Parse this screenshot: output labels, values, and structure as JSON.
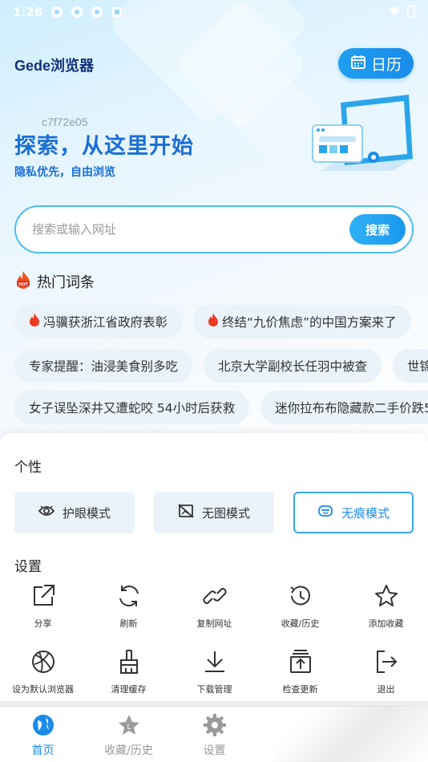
{
  "status_bar": {
    "time": "1:26"
  },
  "header": {
    "app_title": "Gede浏览器",
    "calendar_label": "日历"
  },
  "hero": {
    "code": "c7f72e05",
    "title": "探索，从这里开始",
    "subtitle": "隐私优先，自由浏览"
  },
  "search": {
    "placeholder": "搜索或输入网址",
    "value": "",
    "button_label": "搜索"
  },
  "hot": {
    "title": "热门词条",
    "rows": [
      [
        {
          "text": "冯骥获浙江省政府表彰",
          "fire": true
        },
        {
          "text": "终结“九价焦虑”的中国方案来了",
          "fire": true
        }
      ],
      [
        {
          "text": "专家提醒：油浸美食别多吃",
          "fire": false
        },
        {
          "text": "北京大学副校长任羽中被查",
          "fire": false
        },
        {
          "text": "世锦",
          "fire": false
        }
      ],
      [
        {
          "text": "女子误坠深井又遭蛇咬 54小时后获救",
          "fire": false
        },
        {
          "text": "迷你拉布布隐藏款二手价跌5",
          "fire": false
        }
      ]
    ]
  },
  "sheet": {
    "personal_title": "个性",
    "modes": [
      {
        "label": "护眼模式",
        "icon": "eye-icon",
        "active": false
      },
      {
        "label": "无图模式",
        "icon": "no-image-icon",
        "active": false
      },
      {
        "label": "无痕模式",
        "icon": "incognito-icon",
        "active": true
      }
    ],
    "settings_title": "设置",
    "settings": [
      {
        "label": "分享",
        "icon": "share-icon"
      },
      {
        "label": "刷新",
        "icon": "refresh-icon"
      },
      {
        "label": "复制网址",
        "icon": "link-icon"
      },
      {
        "label": "收藏/历史",
        "icon": "history-icon"
      },
      {
        "label": "添加收藏",
        "icon": "star-icon"
      },
      {
        "label": "设为默认浏览器",
        "icon": "globe-icon"
      },
      {
        "label": "清理缓存",
        "icon": "broom-icon"
      },
      {
        "label": "下载管理",
        "icon": "download-icon"
      },
      {
        "label": "检查更新",
        "icon": "update-icon"
      },
      {
        "label": "退出",
        "icon": "exit-icon"
      }
    ]
  },
  "nav": {
    "items": [
      {
        "label": "首页",
        "icon": "home-globe-icon",
        "active": true
      },
      {
        "label": "收藏/历史",
        "icon": "star-icon",
        "active": false
      },
      {
        "label": "设置",
        "icon": "gear-icon",
        "active": false
      }
    ]
  },
  "colors": {
    "accent": "#1a8be9",
    "hero_text": "#1a6fd6",
    "title": "#12317a"
  }
}
